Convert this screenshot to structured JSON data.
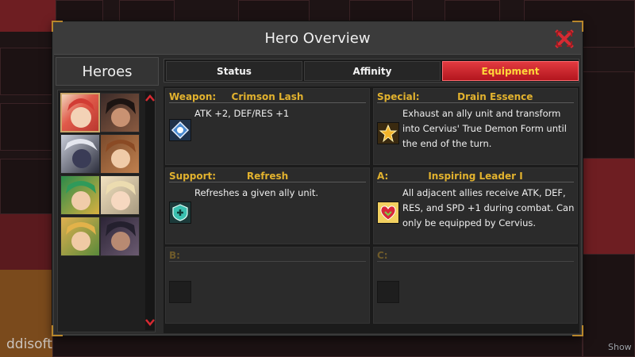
{
  "watermark": "ddisoft",
  "show_label": "Show",
  "window": {
    "title": "Hero Overview"
  },
  "heroes_panel": {
    "title": "Heroes",
    "heroes": [
      {
        "name": "hero-1",
        "selected": true
      },
      {
        "name": "hero-2",
        "selected": false
      },
      {
        "name": "hero-3",
        "selected": false
      },
      {
        "name": "hero-4",
        "selected": false
      },
      {
        "name": "hero-5",
        "selected": false
      },
      {
        "name": "hero-6",
        "selected": false
      },
      {
        "name": "hero-7",
        "selected": false
      },
      {
        "name": "hero-8",
        "selected": false
      }
    ]
  },
  "tabs": [
    {
      "label": "Status"
    },
    {
      "label": "Affinity"
    },
    {
      "label": "Equipment",
      "active": true
    }
  ],
  "equipment": {
    "weapon": {
      "slot": "Weapon:",
      "name": "Crimson Lash",
      "desc": "ATK +2, DEF/RES +1",
      "icon": "weapon-icon"
    },
    "special": {
      "slot": "Special:",
      "name": "Drain Essence",
      "desc": "Exhaust an ally unit and transform into Cervius' True Demon Form until the end of the turn.",
      "icon": "special-icon"
    },
    "support": {
      "slot": "Support:",
      "name": "Refresh",
      "desc": "Refreshes a given ally unit.",
      "icon": "support-icon"
    },
    "a": {
      "slot": "A:",
      "name": "Inspiring Leader I",
      "desc": "All adjacent allies receive ATK, DEF, RES, and SPD +1 during combat. Can only be equipped by Cervius.",
      "icon": "skill-a-icon"
    },
    "b": {
      "slot": "B:",
      "name": "",
      "desc": ""
    },
    "c": {
      "slot": "C:",
      "name": "",
      "desc": ""
    }
  },
  "colors": {
    "accent_gold": "#e2b22e",
    "tab_active_red": "#c81f27",
    "panel_bg": "#2b2b2b"
  }
}
